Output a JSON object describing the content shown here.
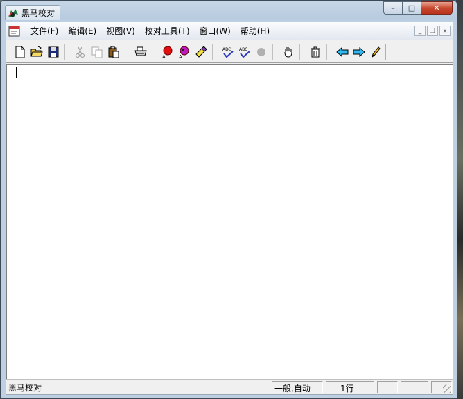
{
  "window": {
    "title": "黑马校对",
    "controls": {
      "minimize": "–",
      "maximize": "□",
      "close": "✕"
    }
  },
  "menubar": {
    "items": [
      {
        "label": "文件(F)"
      },
      {
        "label": "编辑(E)"
      },
      {
        "label": "视图(V)"
      },
      {
        "label": "校对工具(T)"
      },
      {
        "label": "窗口(W)"
      },
      {
        "label": "帮助(H)"
      }
    ],
    "mdi_controls": {
      "minimize": "_",
      "restore": "❐",
      "close": "x"
    }
  },
  "toolbar": {
    "groups": [
      [
        "new-document-icon",
        "open-folder-icon",
        "save-disk-icon"
      ],
      [
        "cut-scissors-icon",
        "copy-icon",
        "paste-clipboard-icon"
      ],
      [
        "print-icon"
      ],
      [
        "proofread-red-icon",
        "proofread-purple-icon",
        "highlighter-icon"
      ],
      [
        "spellcheck-abc-icon",
        "spellcheck-abc-alt-icon",
        "stop-circle-icon"
      ],
      [
        "hand-icon"
      ],
      [
        "trash-icon"
      ],
      [
        "arrow-left-icon",
        "arrow-right-icon",
        "pencil-icon"
      ]
    ]
  },
  "statusbar": {
    "main": "黑马校对",
    "mode": "一般,自动",
    "line": "1行"
  },
  "colors": {
    "title_gradient": "#c6d6e6",
    "close_red": "#c9472e",
    "editor_bg": "#ffffff",
    "chrome_bg": "#f0f0f0"
  }
}
